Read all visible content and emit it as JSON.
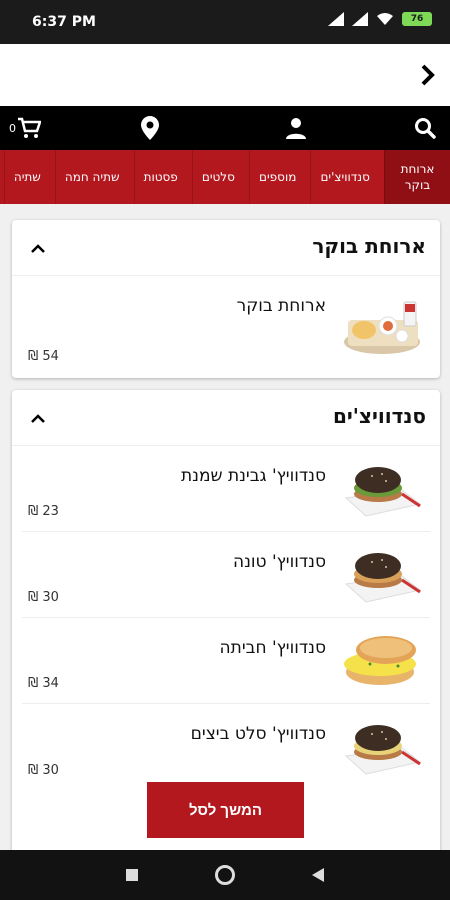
{
  "status_bar": {
    "time": "6:37 PM",
    "battery": "76"
  },
  "categories": [
    {
      "label": "ארוחת בוקר",
      "active": true
    },
    {
      "label": "סנדוויצ'ים",
      "active": false
    },
    {
      "label": "מוספים",
      "active": false
    },
    {
      "label": "סלטים",
      "active": false
    },
    {
      "label": "פסטות",
      "active": false
    },
    {
      "label": "שתיה חמה",
      "active": false
    },
    {
      "label": "שתיה",
      "active": false
    }
  ],
  "sections": [
    {
      "title": "ארוחת בוקר",
      "items": [
        {
          "name": "ארוחת בוקר",
          "price": "54 ₪",
          "image": "breakfast-tray"
        }
      ]
    },
    {
      "title": "סנדוויצ'ים",
      "items": [
        {
          "name": "סנדוויץ' גבינת שמנת",
          "price": "23 ₪",
          "image": "sandwich-dark"
        },
        {
          "name": "סנדוויץ' טונה",
          "price": "30 ₪",
          "image": "sandwich-dark"
        },
        {
          "name": "סנדוויץ' חביתה",
          "price": "34 ₪",
          "image": "bagel-omelette"
        },
        {
          "name": "סנדוויץ' סלט ביצים",
          "price": "30 ₪",
          "image": "sandwich-dark"
        }
      ]
    }
  ],
  "cart": {
    "count": "0"
  },
  "continue_button": "המשך לסל",
  "colors": {
    "brand_red": "#b3181f",
    "active_tab": "#8f0f15",
    "icon_bar": "#000000"
  },
  "icons": {
    "back": "chevron-right-icon",
    "search": "search-icon",
    "account": "person-icon",
    "location": "location-pin-icon",
    "cart": "cart-icon"
  }
}
